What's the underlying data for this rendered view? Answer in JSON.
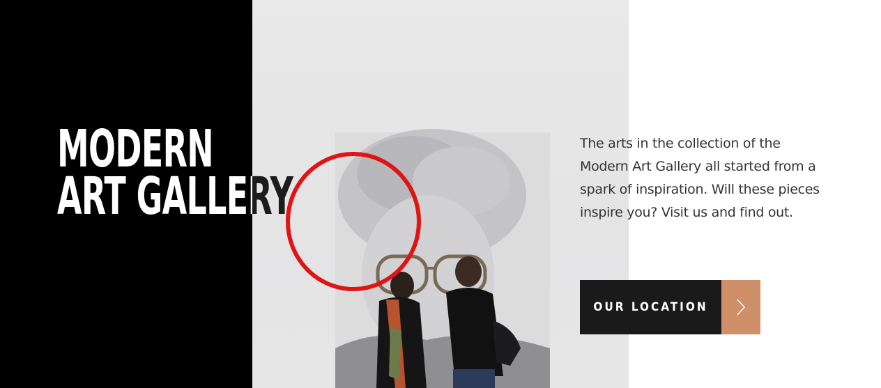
{
  "hero": {
    "title_line1": "MODERN",
    "title_line2": "ART GALLERY",
    "description": "The arts in the collection of the Modern Art Gallery all started from a spark of inspiration. Will these pieces inspire you? Visit us and find out.",
    "cta_label": "OUR LOCATION",
    "cta_icon": "chevron-right-icon"
  },
  "colors": {
    "left_panel": "#000000",
    "cta_background": "#1a1a1a",
    "cta_accent": "#cf8f68",
    "highlight_circle": "#e01414"
  }
}
